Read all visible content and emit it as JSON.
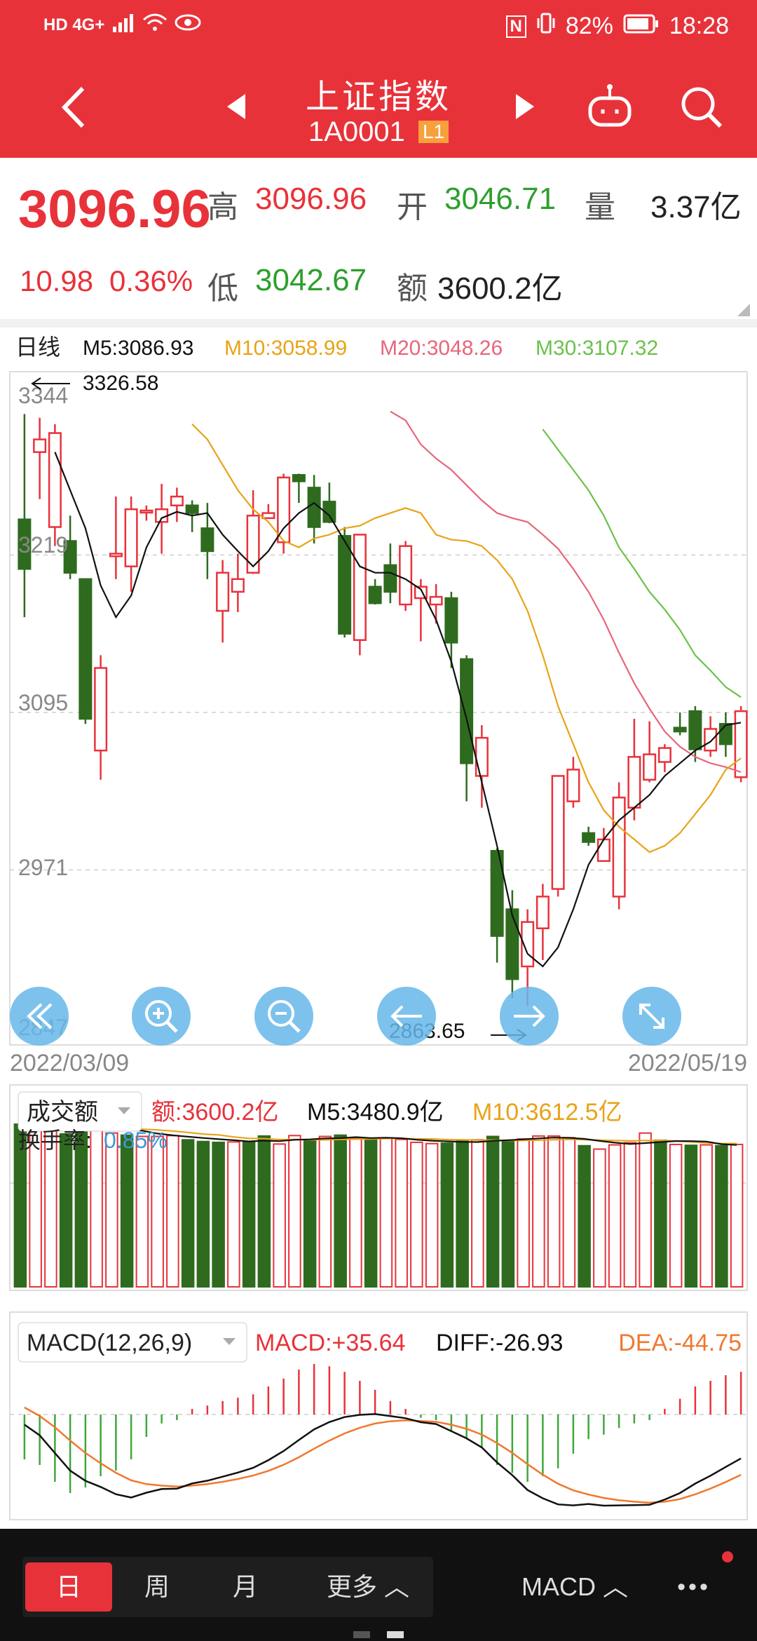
{
  "status_bar": {
    "left": "HD 4G+",
    "battery": "82%",
    "time": "18:28",
    "nfc": "N"
  },
  "header": {
    "title": "上证指数",
    "code": "1A0001",
    "badge": "L1"
  },
  "quote": {
    "price": "3096.96",
    "change": "10.98",
    "change_pct": "0.36%",
    "high_label": "高",
    "high": "3096.96",
    "open_label": "开",
    "open": "3046.71",
    "volume_label": "量",
    "volume": "3.37亿",
    "low_label": "低",
    "low": "3042.67",
    "amount_label": "额",
    "amount": "3600.2亿"
  },
  "colors": {
    "up": "#e8323a",
    "down": "#2f6b1f",
    "ma5": "#111111",
    "ma10": "#e8a317",
    "ma20": "#e8657a",
    "ma30": "#6cc14a",
    "dea": "#f07830",
    "accent": "#e8323a"
  },
  "kline": {
    "period": "日线",
    "ma5": "M5:3086.93",
    "ma10": "M10:3058.99",
    "ma20": "M20:3048.26",
    "ma30": "M30:3107.32",
    "y_ticks": [
      "3344",
      "3219",
      "3095",
      "2971",
      "2847"
    ],
    "max_label": "3326.58",
    "min_label": "2863.65",
    "date_start": "2022/03/09",
    "date_end": "2022/05/19"
  },
  "volume_panel": {
    "selector": "成交额",
    "amount": "额:3600.2亿",
    "m5": "M5:3480.9亿",
    "m10": "M10:3612.5亿",
    "turnover_label": "换手率:",
    "turnover": "0.85%"
  },
  "macd_panel": {
    "selector": "MACD(12,26,9)",
    "macd": "MACD:+35.64",
    "diff": "DIFF:-26.93",
    "dea": "DEA:-44.75"
  },
  "bottom_tabs": [
    "日",
    "周",
    "月",
    "更多 ︿"
  ],
  "indicator_label": "MACD ︿",
  "more_label": "•••",
  "controls": [
    "collapse-left-icon",
    "zoom-in-icon",
    "zoom-out-icon",
    "arrow-left-icon",
    "arrow-right-icon",
    "expand-icon"
  ],
  "chart_data": {
    "type": "candlestick",
    "x_start": "2022/03/09",
    "x_end": "2022/05/19",
    "ylim": [
      2847,
      3344
    ],
    "candles": [
      {
        "o": 3247,
        "h": 3330,
        "l": 3170,
        "c": 3208
      },
      {
        "o": 3300,
        "h": 3327,
        "l": 3263,
        "c": 3310
      },
      {
        "o": 3241,
        "h": 3322,
        "l": 3226,
        "c": 3315
      },
      {
        "o": 3230,
        "h": 3250,
        "l": 3200,
        "c": 3205
      },
      {
        "o": 3200,
        "h": 3140,
        "l": 3086,
        "c": 3090
      },
      {
        "o": 3065,
        "h": 3140,
        "l": 3042,
        "c": 3130
      },
      {
        "o": 3218,
        "h": 3265,
        "l": 3200,
        "c": 3220
      },
      {
        "o": 3210,
        "h": 3265,
        "l": 3190,
        "c": 3255
      },
      {
        "o": 3253,
        "h": 3258,
        "l": 3246,
        "c": 3254
      },
      {
        "o": 3245,
        "h": 3275,
        "l": 3220,
        "c": 3255
      },
      {
        "o": 3258,
        "h": 3272,
        "l": 3245,
        "c": 3265
      },
      {
        "o": 3258,
        "h": 3262,
        "l": 3237,
        "c": 3252
      },
      {
        "o": 3240,
        "h": 3260,
        "l": 3200,
        "c": 3222
      },
      {
        "o": 3175,
        "h": 3215,
        "l": 3150,
        "c": 3205
      },
      {
        "o": 3190,
        "h": 3220,
        "l": 3174,
        "c": 3200
      },
      {
        "o": 3205,
        "h": 3270,
        "l": 3204,
        "c": 3250
      },
      {
        "o": 3248,
        "h": 3259,
        "l": 3250,
        "c": 3252
      },
      {
        "o": 3229,
        "h": 3283,
        "l": 3220,
        "c": 3280
      },
      {
        "o": 3282,
        "h": 3283,
        "l": 3260,
        "c": 3277
      },
      {
        "o": 3272,
        "h": 3282,
        "l": 3228,
        "c": 3241
      },
      {
        "o": 3261,
        "h": 3276,
        "l": 3244,
        "c": 3245
      },
      {
        "o": 3234,
        "h": 3241,
        "l": 3154,
        "c": 3157
      },
      {
        "o": 3152,
        "h": 3235,
        "l": 3140,
        "c": 3235
      },
      {
        "o": 3194,
        "h": 3200,
        "l": 3180,
        "c": 3181
      },
      {
        "o": 3211,
        "h": 3228,
        "l": 3181,
        "c": 3190
      },
      {
        "o": 3180,
        "h": 3230,
        "l": 3175,
        "c": 3226
      },
      {
        "o": 3185,
        "h": 3200,
        "l": 3151,
        "c": 3194
      },
      {
        "o": 3180,
        "h": 3196,
        "l": 3165,
        "c": 3186
      },
      {
        "o": 3185,
        "h": 3190,
        "l": 3130,
        "c": 3150
      },
      {
        "o": 3137,
        "h": 3140,
        "l": 3025,
        "c": 3055
      },
      {
        "o": 3045,
        "h": 3085,
        "l": 3020,
        "c": 3075
      },
      {
        "o": 2986,
        "h": 2988,
        "l": 2898,
        "c": 2919
      },
      {
        "o": 2940,
        "h": 2955,
        "l": 2870,
        "c": 2885
      },
      {
        "o": 2895,
        "h": 2940,
        "l": 2864,
        "c": 2930
      },
      {
        "o": 2925,
        "h": 2960,
        "l": 2900,
        "c": 2950
      },
      {
        "o": 2956,
        "h": 3024,
        "l": 2950,
        "c": 3045
      },
      {
        "o": 3025,
        "h": 3060,
        "l": 3020,
        "c": 3050
      },
      {
        "o": 3000,
        "h": 3005,
        "l": 2990,
        "c": 2993
      },
      {
        "o": 2978,
        "h": 3004,
        "l": 2978,
        "c": 2995
      },
      {
        "o": 2950,
        "h": 3040,
        "l": 2940,
        "c": 3028
      },
      {
        "o": 3020,
        "h": 3090,
        "l": 3010,
        "c": 3060
      },
      {
        "o": 3042,
        "h": 3088,
        "l": 3040,
        "c": 3062
      },
      {
        "o": 3056,
        "h": 3070,
        "l": 3048,
        "c": 3067
      },
      {
        "o": 3083,
        "h": 3095,
        "l": 3077,
        "c": 3080
      },
      {
        "o": 3096,
        "h": 3100,
        "l": 3056,
        "c": 3066
      },
      {
        "o": 3065,
        "h": 3092,
        "l": 3060,
        "c": 3082
      },
      {
        "o": 3086,
        "h": 3095,
        "l": 3060,
        "c": 3070
      },
      {
        "o": 3044,
        "h": 3100,
        "l": 3040,
        "c": 3096
      }
    ],
    "ma5": [
      3300,
      3270,
      3240,
      3195,
      3170,
      3187,
      3225,
      3248,
      3253,
      3250,
      3252,
      3235,
      3222,
      3210,
      3222,
      3240,
      3252,
      3260,
      3250,
      3230,
      3210,
      3205,
      3205,
      3200,
      3192,
      3168,
      3135,
      3090,
      3040,
      2990,
      2935,
      2905,
      2895,
      2910,
      2940,
      2975,
      2995,
      3010,
      3020,
      3030,
      3045,
      3055,
      3065,
      3072,
      3085,
      3087
    ],
    "ma10": [
      3322,
      3310,
      3290,
      3270,
      3255,
      3245,
      3230,
      3225,
      3232,
      3235,
      3240,
      3242,
      3248,
      3252,
      3256,
      3252,
      3235,
      3231,
      3230,
      3226,
      3215,
      3200,
      3175,
      3140,
      3100,
      3070,
      3040,
      3018,
      3005,
      2995,
      2985,
      2990,
      3000,
      3015,
      3030,
      3050,
      3059
    ],
    "ma20": [
      3332,
      3325,
      3306,
      3295,
      3286,
      3274,
      3262,
      3252,
      3248,
      3245,
      3235,
      3224,
      3208,
      3190,
      3168,
      3142,
      3118,
      3098,
      3080,
      3068,
      3060,
      3055,
      3052,
      3048
    ],
    "ma30": [
      3318,
      3302,
      3286,
      3270,
      3250,
      3225,
      3208,
      3190,
      3176,
      3160,
      3140,
      3128,
      3115,
      3107
    ],
    "volume": [
      {
        "v": 3850,
        "up": false
      },
      {
        "v": 3810,
        "up": true
      },
      {
        "v": 3820,
        "up": true
      },
      {
        "v": 3620,
        "up": false
      },
      {
        "v": 3900,
        "up": false
      },
      {
        "v": 3790,
        "up": true
      },
      {
        "v": 3640,
        "up": true
      },
      {
        "v": 3590,
        "up": false
      },
      {
        "v": 3560,
        "up": true
      },
      {
        "v": 3560,
        "up": true
      },
      {
        "v": 3580,
        "up": true
      },
      {
        "v": 3480,
        "up": false
      },
      {
        "v": 3440,
        "up": false
      },
      {
        "v": 3420,
        "up": false
      },
      {
        "v": 3430,
        "up": true
      },
      {
        "v": 3440,
        "up": false
      },
      {
        "v": 3570,
        "up": false
      },
      {
        "v": 3380,
        "up": true
      },
      {
        "v": 3580,
        "up": true
      },
      {
        "v": 3480,
        "up": false
      },
      {
        "v": 3560,
        "up": true
      },
      {
        "v": 3590,
        "up": false
      },
      {
        "v": 3510,
        "up": true
      },
      {
        "v": 3470,
        "up": false
      },
      {
        "v": 3520,
        "up": true
      },
      {
        "v": 3490,
        "up": true
      },
      {
        "v": 3420,
        "up": true
      },
      {
        "v": 3390,
        "up": true
      },
      {
        "v": 3400,
        "up": false
      },
      {
        "v": 3450,
        "up": false
      },
      {
        "v": 3480,
        "up": true
      },
      {
        "v": 3560,
        "up": false
      },
      {
        "v": 3460,
        "up": false
      },
      {
        "v": 3500,
        "up": true
      },
      {
        "v": 3570,
        "up": true
      },
      {
        "v": 3570,
        "up": true
      },
      {
        "v": 3530,
        "up": true
      },
      {
        "v": 3340,
        "up": false
      },
      {
        "v": 3260,
        "up": true
      },
      {
        "v": 3360,
        "up": true
      },
      {
        "v": 3410,
        "up": true
      },
      {
        "v": 3640,
        "up": true
      },
      {
        "v": 3470,
        "up": false
      },
      {
        "v": 3370,
        "up": true
      },
      {
        "v": 3350,
        "up": false
      },
      {
        "v": 3360,
        "up": true
      },
      {
        "v": 3340,
        "up": false
      },
      {
        "v": 3370,
        "up": true
      }
    ],
    "macd_hist": [
      -40,
      -45,
      -60,
      -70,
      -65,
      -55,
      -50,
      -40,
      -20,
      -8,
      -5,
      5,
      8,
      12,
      15,
      18,
      25,
      32,
      40,
      45,
      43,
      38,
      30,
      22,
      12,
      5,
      -3,
      -5,
      -15,
      -22,
      -30,
      -45,
      -52,
      -60,
      -55,
      -48,
      -35,
      -22,
      -18,
      -12,
      -8,
      -5,
      5,
      14,
      25,
      30,
      35,
      38
    ]
  }
}
